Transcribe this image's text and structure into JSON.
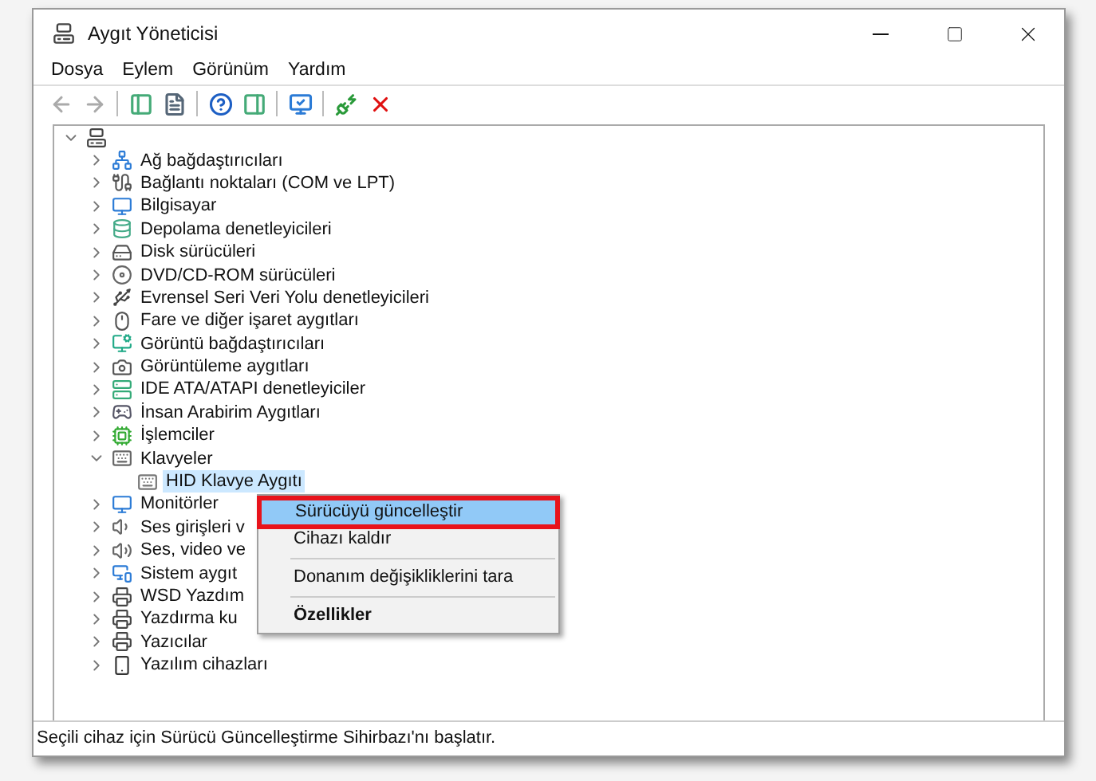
{
  "window": {
    "title": "Aygıt Yöneticisi"
  },
  "menu": [
    "Dosya",
    "Eylem",
    "Görünüm",
    "Yardım"
  ],
  "toolbar": [
    {
      "kind": "back",
      "disabled": true
    },
    {
      "kind": "forward",
      "disabled": true
    },
    {
      "kind": "separator"
    },
    {
      "kind": "tree",
      "disabled": false
    },
    {
      "kind": "properties",
      "disabled": false
    },
    {
      "kind": "separator"
    },
    {
      "kind": "help",
      "disabled": false
    },
    {
      "kind": "pane",
      "disabled": false
    },
    {
      "kind": "separator"
    },
    {
      "kind": "scan",
      "disabled": false
    },
    {
      "kind": "separator"
    },
    {
      "kind": "add",
      "disabled": false
    },
    {
      "kind": "remove",
      "disabled": false
    }
  ],
  "tree": {
    "expanded": true,
    "children": [
      {
        "label": "Ağ bağdaştırıcıları",
        "expanded": false
      },
      {
        "label": "Bağlantı noktaları (COM ve LPT)",
        "expanded": false
      },
      {
        "label": "Bilgisayar",
        "expanded": false
      },
      {
        "label": "Depolama denetleyicileri",
        "expanded": false
      },
      {
        "label": "Disk sürücüleri",
        "expanded": false
      },
      {
        "label": "DVD/CD-ROM sürücüleri",
        "expanded": false
      },
      {
        "label": "Evrensel Seri Veri Yolu denetleyicileri",
        "expanded": false
      },
      {
        "label": "Fare ve diğer işaret aygıtları",
        "expanded": false
      },
      {
        "label": "Görüntü bağdaştırıcıları",
        "expanded": false
      },
      {
        "label": "Görüntüleme aygıtları",
        "expanded": false
      },
      {
        "label": "IDE ATA/ATAPI denetleyiciler",
        "expanded": false
      },
      {
        "label": "İnsan Arabirim Aygıtları",
        "expanded": false
      },
      {
        "label": "İşlemciler",
        "expanded": false
      },
      {
        "label": "Klavyeler",
        "expanded": true,
        "children": [
          {
            "label": "HID Klavye Aygıtı",
            "selected": true
          }
        ]
      },
      {
        "label": "Monitörler",
        "expanded": false
      },
      {
        "label": "Ses girişleri v",
        "expanded": false
      },
      {
        "label": "Ses, video ve",
        "expanded": false
      },
      {
        "label": "Sistem aygıt",
        "expanded": false
      },
      {
        "label": "WSD Yazdım",
        "expanded": false
      },
      {
        "label": "Yazdırma ku",
        "expanded": false
      },
      {
        "label": "Yazıcılar",
        "expanded": false
      },
      {
        "label": "Yazılım cihazları",
        "expanded": false
      }
    ]
  },
  "context_menu": [
    {
      "kind": "item",
      "label": "Sürücüyü güncelleştir",
      "selected": true,
      "bold": false
    },
    {
      "kind": "item",
      "label": "Cihazı kaldır",
      "selected": false,
      "bold": false
    },
    {
      "kind": "separator"
    },
    {
      "kind": "item",
      "label": "Donanım değişikliklerini tara",
      "selected": false,
      "bold": false
    },
    {
      "kind": "separator"
    },
    {
      "kind": "item",
      "label": "Özellikler",
      "selected": false,
      "bold": true
    }
  ],
  "status_bar": "Seçili cihaz için Sürücü Güncelleştirme Sihirbazı'nı başlatır."
}
